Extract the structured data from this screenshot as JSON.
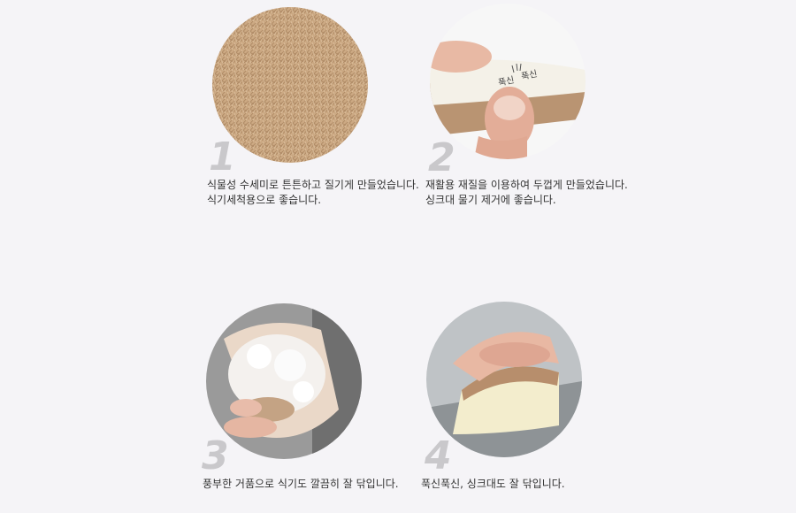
{
  "features": [
    {
      "number": "1",
      "image": "coconut-fiber-texture",
      "lines": [
        "식물성 수세미로 튼튼하고 질기게 만들었습니다.",
        "식기세척용으로 좋습니다."
      ]
    },
    {
      "number": "2",
      "image": "hand-squeezing-sponge",
      "image_labels": [
        "푹신",
        "푹신"
      ],
      "lines": [
        "재활용 재질을 이용하여 두껍게 만들었습니다.",
        "싱크대 물기 제거에 좋습니다."
      ]
    },
    {
      "number": "3",
      "image": "foamy-sponge-in-hand",
      "lines": [
        "풍부한 거품으로 식기도 깔끔히 잘 닦입니다."
      ]
    },
    {
      "number": "4",
      "image": "hand-scrubbing-sink",
      "lines": [
        "푹신푹신, 싱크대도 잘 닦입니다."
      ]
    }
  ],
  "colors": {
    "background": "#f5f4f7",
    "number": "#c9c8cb",
    "text": "#333333",
    "fiber": "#c49f78",
    "sponge": "#f2eedc"
  }
}
